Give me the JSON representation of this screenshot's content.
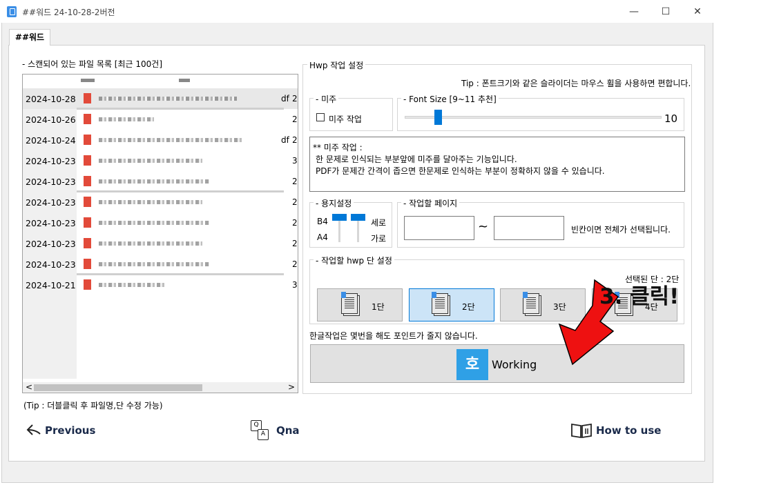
{
  "window": {
    "title": "##워드 24-10-28-2버전",
    "minimize": "—",
    "maximize": "☐",
    "close": "✕"
  },
  "tab": {
    "label": "##워드"
  },
  "file_list": {
    "title": "- 스캔되어 있는 파일 목록 [최근 100건]",
    "rows": [
      {
        "date": "2024-10-28",
        "col3": "2"
      },
      {
        "date": "2024-10-26",
        "col3": "2"
      },
      {
        "date": "2024-10-24",
        "col3": "2"
      },
      {
        "date": "2024-10-23",
        "col3": "3"
      },
      {
        "date": "2024-10-23",
        "col3": "2"
      },
      {
        "date": "2024-10-23",
        "col3": "2"
      },
      {
        "date": "2024-10-23",
        "col3": "2"
      },
      {
        "date": "2024-10-23",
        "col3": "2"
      },
      {
        "date": "2024-10-23",
        "col3": "2"
      },
      {
        "date": "2024-10-21",
        "col3": "3"
      }
    ],
    "partial_suffix": "df",
    "scroll_left": "<",
    "scroll_right": ">",
    "tip": "(Tip : 더블클릭 후 파일명,단 수정 가능)"
  },
  "hwp": {
    "group_title": "Hwp 작업 설정",
    "tip": "Tip : 폰트크기와 같은 슬라이더는 마우스 휠을 사용하면 편합니다.",
    "mizu_group": "- 미주",
    "mizu_checkbox": "미주 작업",
    "font_group": "- Font Size [9~11 추천]",
    "font_value": "10",
    "font_level": 0.12,
    "info_lines": [
      "** 미주 작업 :",
      "한 문제로 인식되는 부분앞에 미주를 달아주는 기능입니다.",
      "PDF가 문제간 간격이 좁으면 한문제로 인식하는 부분이 정확하지 않을 수 있습니다."
    ],
    "paper_group": "- 용지설정",
    "paper_b4": "B4",
    "paper_a4": "A4",
    "paper_portrait": "세로",
    "paper_landscape": "가로",
    "page_group": "- 작업할 페이지",
    "page_tilde": "~",
    "page_hint": "빈칸이면 전체가 선택됩니다.",
    "column_group": "- 작업할 hwp 단 설정",
    "selected_text": "선택된 단 : 2단",
    "col_buttons": [
      "1단",
      "2단",
      "3단",
      "4단"
    ],
    "note": "한글작업은 몇번을 해도 포인트가 줄지 않습니다.",
    "working_logo": "호",
    "working_label": "Working"
  },
  "annotation": {
    "text": "3. 클릭!",
    "arrow_color": "#ee1111"
  },
  "footer": {
    "previous": "Previous",
    "qna": "Qna",
    "qna_q": "Q",
    "qna_a": "A",
    "how_to_use": "How to use"
  }
}
